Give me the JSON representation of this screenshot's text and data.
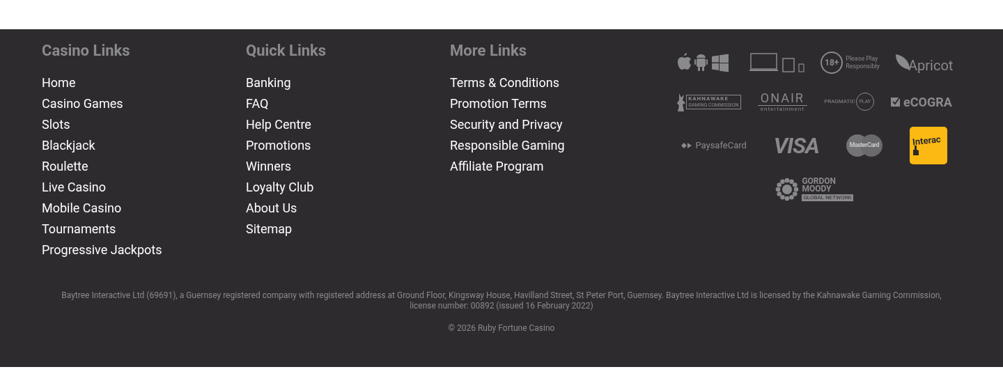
{
  "columns": [
    {
      "title": "Casino Links",
      "links": [
        "Home",
        "Casino Games",
        "Slots",
        "Blackjack",
        "Roulette",
        "Live Casino",
        "Mobile Casino",
        "Tournaments",
        "Progressive Jackpots"
      ]
    },
    {
      "title": "Quick Links",
      "links": [
        "Banking",
        "FAQ",
        "Help Centre",
        "Promotions",
        "Winners",
        "Loyalty Club",
        "About Us",
        "Sitemap"
      ]
    },
    {
      "title": "More Links",
      "links": [
        "Terms & Conditions",
        "Promotion Terms",
        "Security and Privacy",
        "Responsible Gaming",
        "Affiliate Program"
      ]
    }
  ],
  "logo_rows": [
    [
      {
        "kind": "platforms"
      },
      {
        "kind": "devices"
      },
      {
        "kind": "age",
        "badge": "18+",
        "lines": [
          "Please Play",
          "Responsibly"
        ]
      },
      {
        "kind": "apricot",
        "text": "Apricot"
      }
    ],
    [
      {
        "kind": "kahnawake",
        "text": "KAHNAWAKE",
        "sub": "GAMING COMMISSION"
      },
      {
        "kind": "onair",
        "text": "ONAIR",
        "sub": "entertainment"
      },
      {
        "kind": "pragmatic",
        "text": "PRAGMATIC",
        "badge": "PLAY"
      },
      {
        "kind": "ecogra",
        "text": "eCOGRA"
      }
    ],
    [
      {
        "kind": "paysafe",
        "text": "PaysafeCard"
      },
      {
        "kind": "visa",
        "text": "VISA"
      },
      {
        "kind": "mastercard",
        "text": "MasterCard"
      },
      {
        "kind": "interac",
        "text": "Interac"
      }
    ],
    [
      {
        "kind": "gordon",
        "lines": [
          "GORDON",
          "MOODY"
        ],
        "sub": "GLOBAL NETWORK"
      }
    ]
  ],
  "legal": "Baytree Interactive Ltd (69691), a Guernsey registered company with registered address at Ground Floor, Kingsway House, Havilland Street, St Peter Port, Guernsey. Baytree Interactive Ltd is licensed by the Kahnawake Gaming Commission, license number: 00892 (issued 16 February 2022)",
  "copyright": "© 2026 Ruby Fortune Casino"
}
